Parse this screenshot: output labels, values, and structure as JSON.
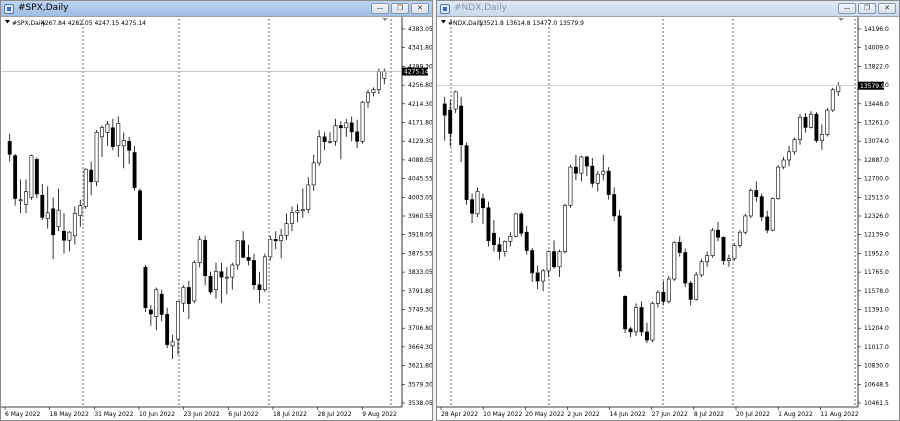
{
  "windows": [
    {
      "title": "#SPX,Daily",
      "header_symbol": "#SPX,Daily",
      "header_ohlc": "4267.84 4282.05 4247.15 4275.14",
      "price_labels": [
        "4383.05",
        "4341.80",
        "4299.30",
        "4256.80",
        "4214.30",
        "4171.80",
        "4129.30",
        "4088.05",
        "4045.55",
        "4003.05",
        "3960.55",
        "3918.05",
        "3875.55",
        "3833.05",
        "3791.80",
        "3749.30",
        "3706.80",
        "3664.30",
        "3621.80",
        "3579.30",
        "3538.05"
      ],
      "date_labels": [
        "6 May 2022",
        "18 May 2022",
        "31 May 2022",
        "10 Jun 2022",
        "23 Jun 2022",
        "6 Jul 2022",
        "18 Jul 2022",
        "28 Jul 2022",
        "9 Aug 2022"
      ],
      "current_price": "4275.14",
      "ylim": [
        3538.05,
        4383.05
      ],
      "candles": [
        [
          4120,
          4137,
          4075,
          4091
        ],
        [
          4088,
          4092,
          3977,
          3993
        ],
        [
          3990,
          4035,
          3960,
          3990
        ],
        [
          3980,
          4035,
          3960,
          4008
        ],
        [
          3995,
          4090,
          3990,
          4088
        ],
        [
          4080,
          4084,
          3994,
          4003
        ],
        [
          4000,
          4025,
          3945,
          3951
        ],
        [
          3948,
          4020,
          3926,
          3961
        ],
        [
          3970,
          3995,
          3858,
          3912
        ],
        [
          3930,
          4015,
          3920,
          3967
        ],
        [
          3920,
          3960,
          3870,
          3900
        ],
        [
          3900,
          3920,
          3875,
          3918
        ],
        [
          3910,
          3975,
          3890,
          3960
        ],
        [
          3955,
          3990,
          3930,
          3977
        ],
        [
          3975,
          4060,
          3970,
          4058
        ],
        [
          4056,
          4075,
          4000,
          4030
        ],
        [
          4030,
          4145,
          4020,
          4140
        ],
        [
          4130,
          4155,
          4085,
          4151
        ],
        [
          4140,
          4165,
          4110,
          4158
        ],
        [
          4150,
          4170,
          4100,
          4108
        ],
        [
          4110,
          4175,
          4085,
          4160
        ],
        [
          4110,
          4140,
          4060,
          4122
        ],
        [
          4120,
          4130,
          4070,
          4100
        ],
        [
          4095,
          4110,
          4010,
          4017
        ],
        [
          4010,
          4015,
          3900,
          3901
        ],
        [
          3840,
          3845,
          3740,
          3750
        ],
        [
          3745,
          3756,
          3710,
          3736
        ],
        [
          3730,
          3795,
          3700,
          3790
        ],
        [
          3780,
          3790,
          3720,
          3735
        ],
        [
          3735,
          3750,
          3660,
          3668
        ],
        [
          3665,
          3690,
          3636,
          3674
        ],
        [
          3680,
          3765,
          3645,
          3764
        ],
        [
          3760,
          3800,
          3740,
          3795
        ],
        [
          3795,
          3810,
          3725,
          3759
        ],
        [
          3765,
          3855,
          3760,
          3850
        ],
        [
          3850,
          3910,
          3840,
          3901
        ],
        [
          3900,
          3910,
          3800,
          3821
        ],
        [
          3820,
          3830,
          3780,
          3785
        ],
        [
          3790,
          3850,
          3770,
          3831
        ],
        [
          3830,
          3850,
          3760,
          3818
        ],
        [
          3818,
          3840,
          3780,
          3818
        ],
        [
          3818,
          3850,
          3790,
          3845
        ],
        [
          3845,
          3900,
          3835,
          3899
        ],
        [
          3899,
          3920,
          3860,
          3862
        ],
        [
          3862,
          3890,
          3844,
          3855
        ],
        [
          3855,
          3870,
          3790,
          3801
        ],
        [
          3801,
          3830,
          3760,
          3790
        ],
        [
          3790,
          3870,
          3785,
          3863
        ],
        [
          3863,
          3910,
          3855,
          3902
        ],
        [
          3902,
          3920,
          3880,
          3899
        ],
        [
          3899,
          3925,
          3860,
          3911
        ],
        [
          3911,
          3960,
          3900,
          3937
        ],
        [
          3937,
          3975,
          3920,
          3962
        ],
        [
          3962,
          3980,
          3940,
          3966
        ],
        [
          3966,
          4015,
          3950,
          3968
        ],
        [
          3968,
          4040,
          3960,
          4023
        ],
        [
          4023,
          4090,
          4010,
          4072
        ],
        [
          4072,
          4145,
          4065,
          4130
        ],
        [
          4130,
          4140,
          4100,
          4119
        ],
        [
          4119,
          4140,
          4115,
          4120
        ],
        [
          4120,
          4170,
          4110,
          4155
        ],
        [
          4155,
          4165,
          4080,
          4150
        ],
        [
          4150,
          4170,
          4130,
          4161
        ],
        [
          4161,
          4175,
          4120,
          4141
        ],
        [
          4141,
          4168,
          4105,
          4120
        ],
        [
          4120,
          4210,
          4115,
          4207
        ],
        [
          4207,
          4235,
          4195,
          4228
        ],
        [
          4228,
          4240,
          4220,
          4235
        ],
        [
          4235,
          4282,
          4225,
          4275
        ],
        [
          4260,
          4282,
          4247,
          4275
        ]
      ]
    },
    {
      "title": "#NDX,Daily",
      "header_symbol": "#NDX,Daily",
      "header_ohlc": "13521.8 13614.8 13477.0 13579.9",
      "price_labels": [
        "14196.0",
        "14009.0",
        "13822.0",
        "13635.0",
        "13448.0",
        "13261.0",
        "13074.0",
        "12887.0",
        "12700.0",
        "12513.0",
        "12326.0",
        "12139.0",
        "11952.0",
        "11765.0",
        "11578.0",
        "11391.0",
        "11204.0",
        "11017.0",
        "10830.0",
        "10648.5",
        "10461.5"
      ],
      "date_labels": [
        "28 Apr 2022",
        "10 May 2022",
        "20 May 2022",
        "2 Jun 2022",
        "14 Jun 2022",
        "27 Jun 2022",
        "8 Jul 2022",
        "20 Jul 2022",
        "1 Aug 2022",
        "11 Aug 2022"
      ],
      "current_price": "13579.9",
      "ylim": [
        10461.5,
        14196.0
      ],
      "candles": [
        [
          13400,
          13470,
          13040,
          13290
        ],
        [
          13340,
          13440,
          12980,
          13110
        ],
        [
          13350,
          13530,
          13310,
          13520
        ],
        [
          13380,
          13470,
          12830,
          13000
        ],
        [
          12990,
          13020,
          12410,
          12460
        ],
        [
          12460,
          12520,
          12230,
          12325
        ],
        [
          12320,
          12580,
          12290,
          12540
        ],
        [
          12470,
          12520,
          12220,
          12380
        ],
        [
          12380,
          12440,
          12000,
          12056
        ],
        [
          12130,
          12260,
          11950,
          12018
        ],
        [
          12018,
          12090,
          11870,
          11950
        ],
        [
          11950,
          12060,
          11900,
          12050
        ],
        [
          12050,
          12140,
          12000,
          12100
        ],
        [
          12100,
          12330,
          12090,
          12320
        ],
        [
          12320,
          12340,
          12100,
          12130
        ],
        [
          12140,
          12200,
          11920,
          11960
        ],
        [
          11960,
          11985,
          11650,
          11740
        ],
        [
          11740,
          11810,
          11580,
          11660
        ],
        [
          11660,
          11780,
          11560,
          11760
        ],
        [
          11760,
          11960,
          11700,
          11950
        ],
        [
          11950,
          12060,
          11780,
          11800
        ],
        [
          11800,
          11970,
          11700,
          11950
        ],
        [
          11950,
          12420,
          11930,
          12405
        ],
        [
          12405,
          12800,
          12380,
          12780
        ],
        [
          12780,
          12900,
          12650,
          12720
        ],
        [
          12720,
          12890,
          12640,
          12880
        ],
        [
          12880,
          12890,
          12690,
          12790
        ],
        [
          12790,
          12870,
          12580,
          12620
        ],
        [
          12620,
          12740,
          12540,
          12710
        ],
        [
          12710,
          12900,
          12650,
          12740
        ],
        [
          12740,
          12780,
          12460,
          12510
        ],
        [
          12510,
          12580,
          12250,
          12300
        ],
        [
          12300,
          12360,
          11700,
          11760
        ],
        [
          11510,
          11520,
          11150,
          11190
        ],
        [
          11190,
          11210,
          11110,
          11160
        ],
        [
          11160,
          11440,
          11120,
          11400
        ],
        [
          11400,
          11460,
          11120,
          11160
        ],
        [
          11160,
          11250,
          11050,
          11080
        ],
        [
          11080,
          11460,
          11060,
          11440
        ],
        [
          11440,
          11570,
          11400,
          11550
        ],
        [
          11550,
          11660,
          11420,
          11460
        ],
        [
          11460,
          11710,
          11440,
          11680
        ],
        [
          11680,
          12050,
          11660,
          12040
        ],
        [
          12040,
          12100,
          11900,
          11940
        ],
        [
          11940,
          11980,
          11600,
          11640
        ],
        [
          11640,
          11660,
          11420,
          11480
        ],
        [
          11480,
          11750,
          11470,
          11720
        ],
        [
          11720,
          11880,
          11700,
          11850
        ],
        [
          11850,
          11950,
          11800,
          11910
        ],
        [
          11910,
          12180,
          11890,
          12160
        ],
        [
          12160,
          12240,
          12050,
          12090
        ],
        [
          12090,
          12100,
          11820,
          11860
        ],
        [
          11860,
          11920,
          11800,
          11880
        ],
        [
          11880,
          12030,
          11860,
          12010
        ],
        [
          12010,
          12160,
          11990,
          12140
        ],
        [
          12140,
          12320,
          12120,
          12300
        ],
        [
          12300,
          12570,
          12280,
          12550
        ],
        [
          12550,
          12640,
          12440,
          12490
        ],
        [
          12490,
          12520,
          12250,
          12290
        ],
        [
          12290,
          12350,
          12130,
          12160
        ],
        [
          12160,
          12480,
          12150,
          12470
        ],
        [
          12470,
          12800,
          12460,
          12780
        ],
        [
          12780,
          12880,
          12760,
          12850
        ],
        [
          12850,
          12990,
          12790,
          12930
        ],
        [
          12930,
          13070,
          12900,
          13050
        ],
        [
          13050,
          13300,
          13000,
          13270
        ],
        [
          13270,
          13310,
          13120,
          13170
        ],
        [
          13170,
          13330,
          13160,
          13300
        ],
        [
          13300,
          13320,
          13020,
          13040
        ],
        [
          13040,
          13200,
          12950,
          13100
        ],
        [
          13100,
          13360,
          13080,
          13340
        ],
        [
          13340,
          13560,
          13320,
          13540
        ],
        [
          13521.8,
          13614.8,
          13477.0,
          13579.9
        ]
      ]
    }
  ]
}
